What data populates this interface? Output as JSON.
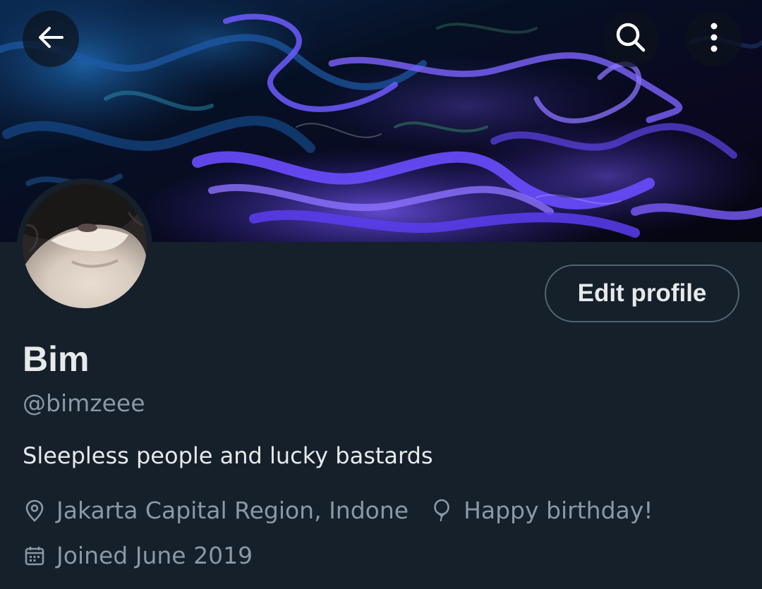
{
  "topbar": {
    "back_icon": "arrow-left-icon",
    "search_icon": "search-icon",
    "more_icon": "more-vertical-icon"
  },
  "profile": {
    "edit_button_label": "Edit profile",
    "display_name": "Bim",
    "handle": "@bimzeee",
    "bio": "Sleepless people and lucky bastards",
    "location": "Jakarta Capital Region, Indone",
    "birthday": "Happy birthday!",
    "joined": "Joined June 2019"
  },
  "colors": {
    "background": "#15202b",
    "primary_text": "#e7e9ea",
    "secondary_text": "#8b98a5",
    "button_border": "#536471",
    "banner_accent": "#6a4cff"
  }
}
